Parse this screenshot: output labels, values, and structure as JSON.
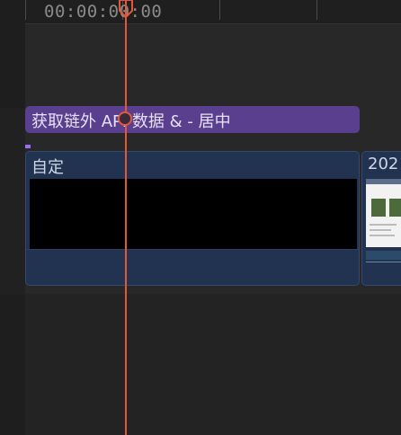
{
  "ruler": {
    "timecode": "00:00:00:00"
  },
  "title_clip": {
    "label": "获取链外 API 数据 & - 居中"
  },
  "video_clip": {
    "label": "自定"
  },
  "video_clip_2": {
    "label": "202"
  },
  "colors": {
    "playhead": "#e2583a",
    "title_clip": "#5a3f8f",
    "video_clip": "#213350",
    "background": "#252525"
  }
}
